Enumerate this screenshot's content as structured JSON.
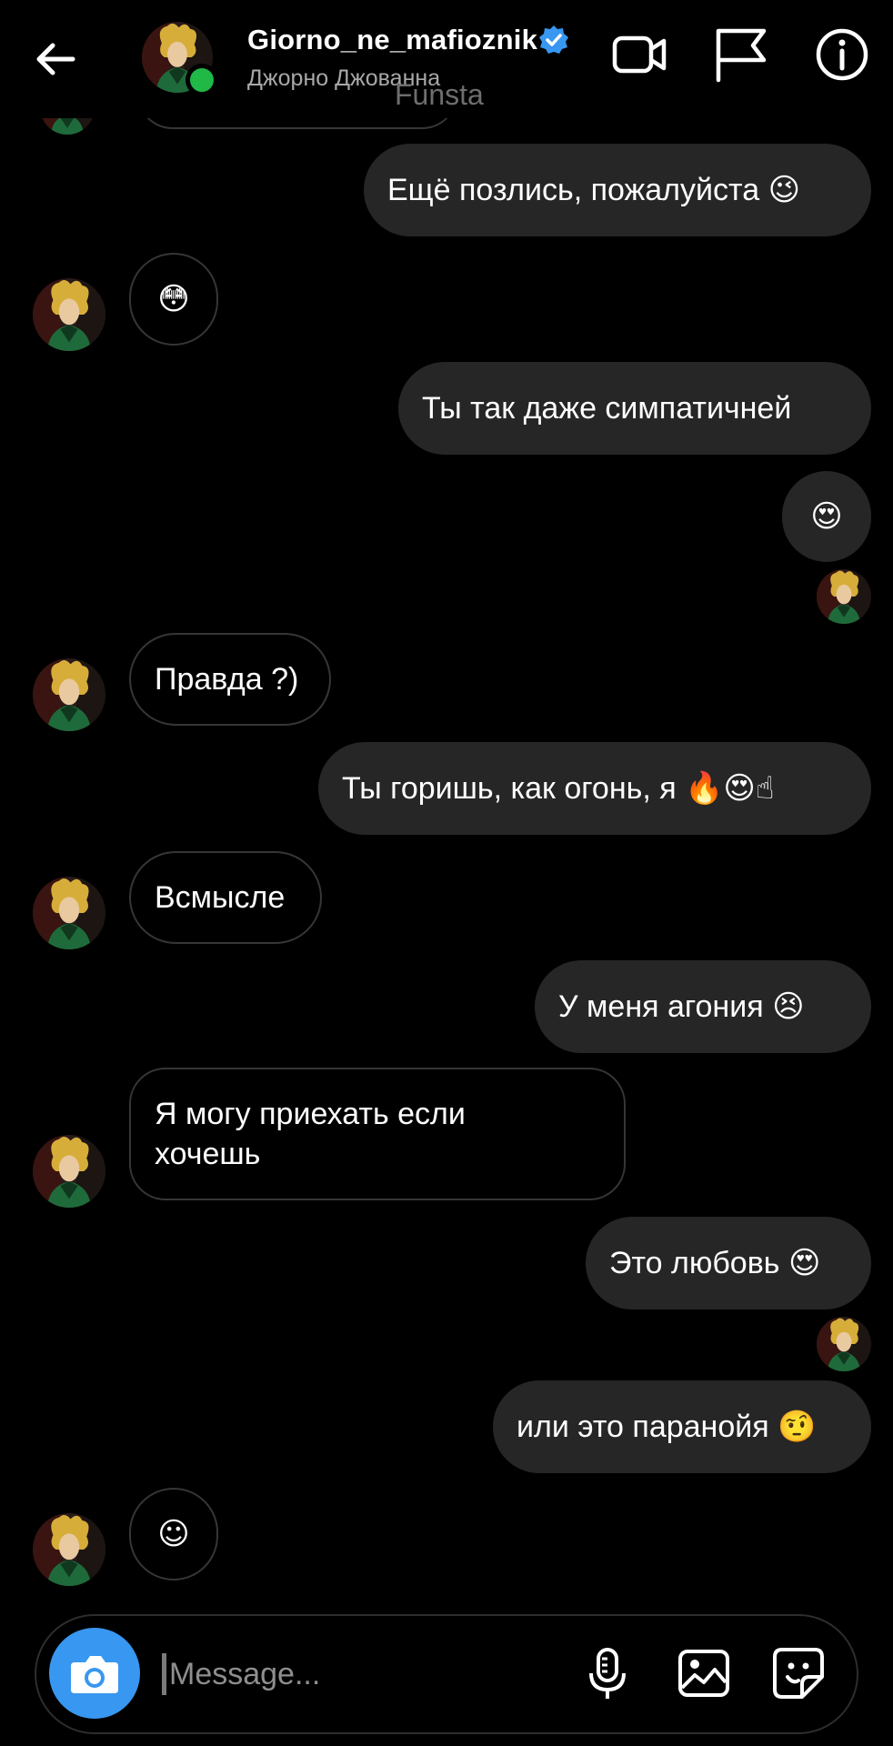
{
  "header": {
    "username": "Giorno_ne_mafioznik",
    "subtitle": "Джорно Джованна",
    "overlay_text": "Funsta",
    "icons": [
      "back-arrow-icon",
      "verified-badge-icon",
      "video-call-icon",
      "flag-icon",
      "info-icon"
    ]
  },
  "messages": [
    {
      "id": "m1",
      "dir": "out",
      "text": "Ещё позлись, пожалуйста",
      "emoji": "😉"
    },
    {
      "id": "m2",
      "dir": "in",
      "text": "",
      "emoji": "😳"
    },
    {
      "id": "m3",
      "dir": "out",
      "text": "Ты так даже симпатичней",
      "emoji": ""
    },
    {
      "id": "m4",
      "dir": "out",
      "text": "",
      "emoji": "😍"
    },
    {
      "id": "m5",
      "dir": "in",
      "text": "Правда ?)",
      "emoji": ""
    },
    {
      "id": "m6",
      "dir": "out",
      "text": "Ты горишь, как огонь, я",
      "emoji": "🔥😍☝"
    },
    {
      "id": "m7",
      "dir": "in",
      "text": "Всмысле",
      "emoji": ""
    },
    {
      "id": "m8",
      "dir": "out",
      "text": "У меня агония",
      "emoji": "😣"
    },
    {
      "id": "m9",
      "dir": "in",
      "text": "Я могу приехать если хочешь",
      "line1": "Я могу приехать если",
      "line2": "хочешь",
      "emoji": ""
    },
    {
      "id": "m10",
      "dir": "out",
      "text": "Это любовь",
      "emoji": "😍"
    },
    {
      "id": "m11",
      "dir": "out",
      "text": "или это паранойя",
      "emoji": "🤨"
    },
    {
      "id": "m12",
      "dir": "in",
      "text": "",
      "emoji": "☺"
    }
  ],
  "composer": {
    "placeholder": "Message...",
    "icons": [
      "camera-icon",
      "microphone-icon",
      "gallery-icon",
      "sticker-icon"
    ]
  },
  "colors": {
    "background": "#000000",
    "outgoing_bubble": "#262626",
    "incoming_border": "#363636",
    "accent_blue": "#3897f0",
    "online_green": "#20b846"
  }
}
